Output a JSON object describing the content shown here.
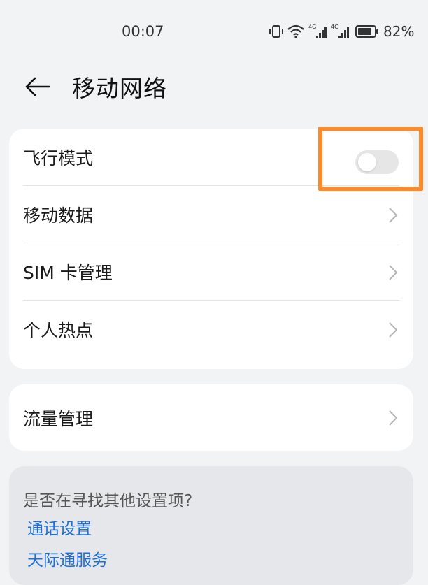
{
  "status_bar": {
    "time": "00:07",
    "battery_percent": "82%",
    "network_labels": [
      "4G",
      "4G"
    ]
  },
  "header": {
    "title": "移动网络"
  },
  "settings": {
    "airplane_mode": {
      "label": "飞行模式",
      "enabled": false
    },
    "mobile_data": {
      "label": "移动数据"
    },
    "sim_management": {
      "label": "SIM 卡管理"
    },
    "hotspot": {
      "label": "个人热点"
    },
    "data_usage": {
      "label": "流量管理"
    }
  },
  "suggestions": {
    "prompt": "是否在寻找其他设置项?",
    "links": [
      {
        "label": "通话设置"
      },
      {
        "label": "天际通服务"
      }
    ]
  },
  "colors": {
    "accent_link": "#1e6fd9",
    "highlight": "#ff8a2a",
    "background": "#f1f3f5"
  }
}
